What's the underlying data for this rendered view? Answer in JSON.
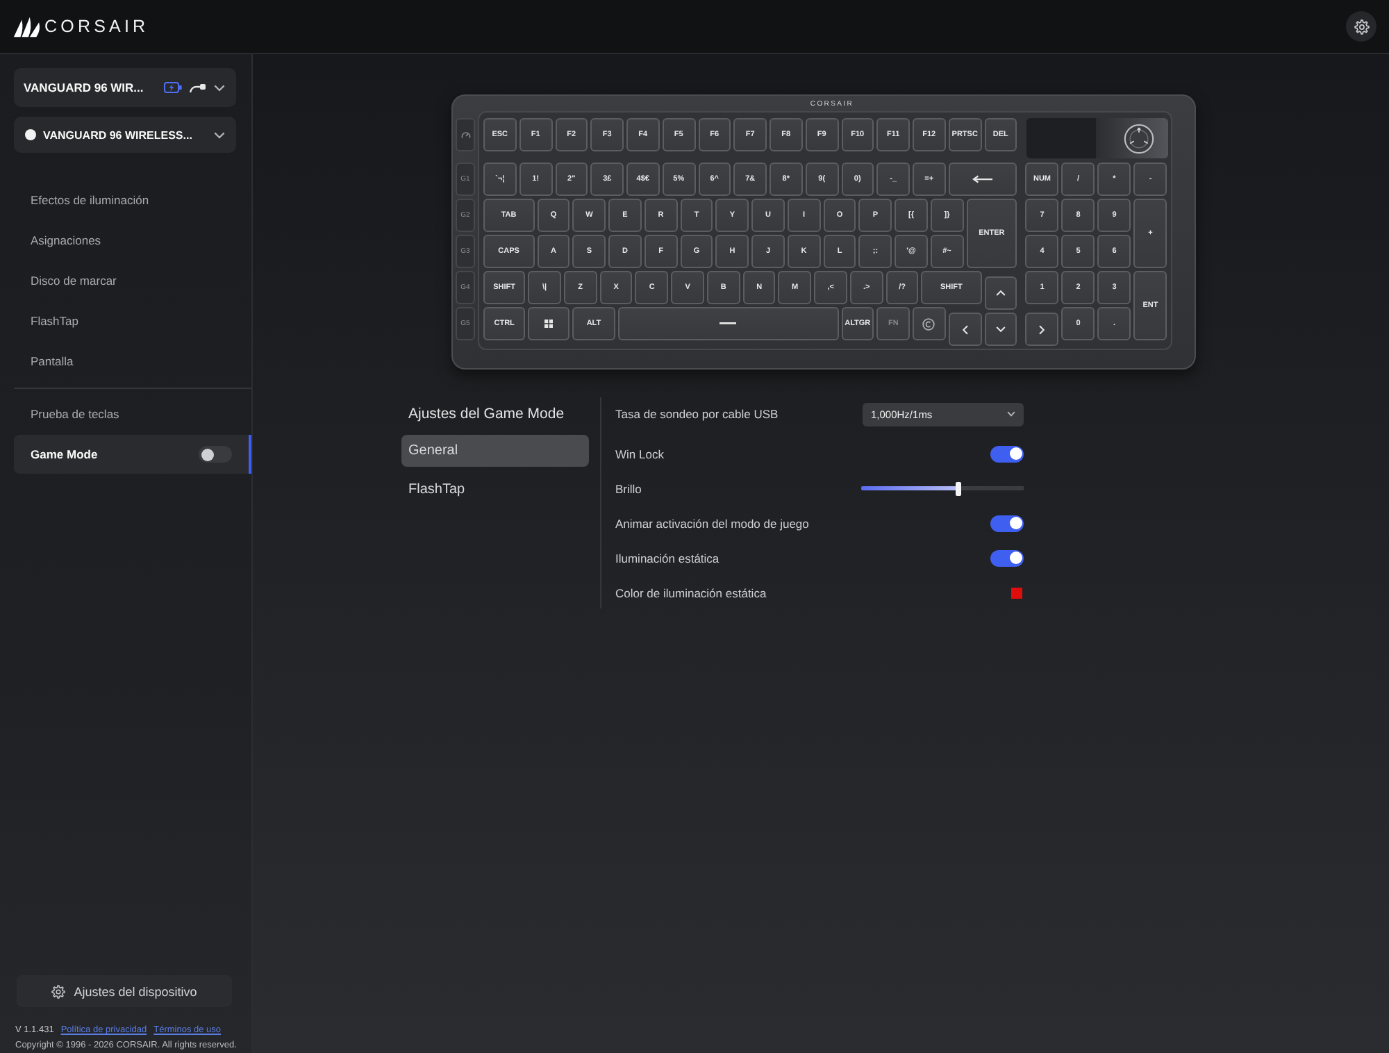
{
  "top_bar": {
    "brand": "CORSAIR"
  },
  "sidebar": {
    "device_selectors": [
      {
        "kind": "device",
        "label": "VANGUARD 96 WIR..."
      },
      {
        "kind": "receiver",
        "label": "VANGUARD 96 WIRELESS..."
      }
    ],
    "menu_groups": [
      {
        "items": [
          {
            "kind": "link",
            "label": "Efectos de iluminación",
            "selected": false
          },
          {
            "kind": "link",
            "label": "Asignaciones",
            "selected": false
          },
          {
            "kind": "link",
            "label": "Disco de marcar",
            "selected": false
          },
          {
            "kind": "link",
            "label": "FlashTap",
            "selected": false
          },
          {
            "kind": "link",
            "label": "Pantalla",
            "selected": false
          }
        ]
      },
      {
        "items": [
          {
            "kind": "link",
            "label": "Prueba de teclas",
            "selected": false
          },
          {
            "kind": "toggle",
            "label": "Game Mode",
            "selected": true,
            "on": false
          }
        ]
      }
    ],
    "device_settings_button": "Ajustes del dispositivo",
    "footer": {
      "version": "V 1.1.431",
      "links": [
        "Política de privacidad",
        "Términos de uso"
      ],
      "copyright": "Copyright © 1996 - 2026 CORSAIR. All rights reserved."
    }
  },
  "keyboard": {
    "brand": "CORSAIR",
    "macro_keys": [
      "G1",
      "G2",
      "G3",
      "G4",
      "G5"
    ],
    "rows": [
      {
        "keys": [
          {
            "kind": "text",
            "label": "ESC"
          },
          {
            "kind": "text",
            "label": "F1"
          },
          {
            "kind": "text",
            "label": "F2"
          },
          {
            "kind": "text",
            "label": "F3"
          },
          {
            "kind": "text",
            "label": "F4"
          },
          {
            "kind": "text",
            "label": "F5"
          },
          {
            "kind": "text",
            "label": "F6"
          },
          {
            "kind": "text",
            "label": "F7"
          },
          {
            "kind": "text",
            "label": "F8"
          },
          {
            "kind": "text",
            "label": "F9"
          },
          {
            "kind": "text",
            "label": "F10"
          },
          {
            "kind": "text",
            "label": "F11"
          },
          {
            "kind": "text",
            "label": "F12"
          },
          {
            "kind": "text",
            "label": "PRTSC"
          },
          {
            "kind": "text",
            "label": "DEL"
          }
        ]
      },
      {
        "keys": [
          {
            "kind": "text",
            "label": "`¬¦"
          },
          {
            "kind": "text",
            "label": "1!"
          },
          {
            "kind": "text",
            "label": "2\""
          },
          {
            "kind": "text",
            "label": "3£"
          },
          {
            "kind": "text",
            "label": "4$€"
          },
          {
            "kind": "text",
            "label": "5%"
          },
          {
            "kind": "text",
            "label": "6^"
          },
          {
            "kind": "text",
            "label": "7&"
          },
          {
            "kind": "text",
            "label": "8*"
          },
          {
            "kind": "text",
            "label": "9("
          },
          {
            "kind": "text",
            "label": "0)"
          },
          {
            "kind": "text",
            "label": "-_"
          },
          {
            "kind": "text",
            "label": "=+"
          },
          {
            "kind": "backspace"
          },
          {
            "kind": "text",
            "label": "NUM"
          },
          {
            "kind": "text",
            "label": "/"
          },
          {
            "kind": "text",
            "label": "*"
          },
          {
            "kind": "text",
            "label": "-"
          }
        ]
      },
      {
        "keys": [
          {
            "kind": "text",
            "label": "TAB"
          },
          {
            "kind": "text",
            "label": "Q"
          },
          {
            "kind": "text",
            "label": "W"
          },
          {
            "kind": "text",
            "label": "E"
          },
          {
            "kind": "text",
            "label": "R"
          },
          {
            "kind": "text",
            "label": "T"
          },
          {
            "kind": "text",
            "label": "Y"
          },
          {
            "kind": "text",
            "label": "U"
          },
          {
            "kind": "text",
            "label": "I"
          },
          {
            "kind": "text",
            "label": "O"
          },
          {
            "kind": "text",
            "label": "P"
          },
          {
            "kind": "text",
            "label": "[{"
          },
          {
            "kind": "text",
            "label": "]}"
          },
          {
            "kind": "text",
            "label": "ENTER"
          },
          {
            "kind": "text",
            "label": "7"
          },
          {
            "kind": "text",
            "label": "8"
          },
          {
            "kind": "text",
            "label": "9"
          },
          {
            "kind": "text",
            "label": "+"
          }
        ]
      },
      {
        "keys": [
          {
            "kind": "text",
            "label": "CAPS"
          },
          {
            "kind": "text",
            "label": "A"
          },
          {
            "kind": "text",
            "label": "S"
          },
          {
            "kind": "text",
            "label": "D"
          },
          {
            "kind": "text",
            "label": "F"
          },
          {
            "kind": "text",
            "label": "G"
          },
          {
            "kind": "text",
            "label": "H"
          },
          {
            "kind": "text",
            "label": "J"
          },
          {
            "kind": "text",
            "label": "K"
          },
          {
            "kind": "text",
            "label": "L"
          },
          {
            "kind": "text",
            "label": ";:"
          },
          {
            "kind": "text",
            "label": "'@"
          },
          {
            "kind": "text",
            "label": "#~"
          },
          {
            "kind": "text",
            "label": "4"
          },
          {
            "kind": "text",
            "label": "5"
          },
          {
            "kind": "text",
            "label": "6"
          }
        ]
      },
      {
        "keys": [
          {
            "kind": "text",
            "label": "SHIFT"
          },
          {
            "kind": "text",
            "label": "\\|"
          },
          {
            "kind": "text",
            "label": "Z"
          },
          {
            "kind": "text",
            "label": "X"
          },
          {
            "kind": "text",
            "label": "C"
          },
          {
            "kind": "text",
            "label": "V"
          },
          {
            "kind": "text",
            "label": "B"
          },
          {
            "kind": "text",
            "label": "N"
          },
          {
            "kind": "text",
            "label": "M"
          },
          {
            "kind": "text",
            "label": ",<"
          },
          {
            "kind": "text",
            "label": ".>"
          },
          {
            "kind": "text",
            "label": "/?"
          },
          {
            "kind": "text",
            "label": "SHIFT"
          },
          {
            "kind": "up"
          },
          {
            "kind": "text",
            "label": "1"
          },
          {
            "kind": "text",
            "label": "2"
          },
          {
            "kind": "text",
            "label": "3"
          },
          {
            "kind": "text",
            "label": "ENT"
          }
        ]
      },
      {
        "keys": [
          {
            "kind": "text",
            "label": "CTRL"
          },
          {
            "kind": "win"
          },
          {
            "kind": "text",
            "label": "ALT"
          },
          {
            "kind": "space"
          },
          {
            "kind": "text",
            "label": "ALTGR"
          },
          {
            "kind": "dim",
            "label": "FN"
          },
          {
            "kind": "logo"
          },
          {
            "kind": "left"
          },
          {
            "kind": "down"
          },
          {
            "kind": "right"
          },
          {
            "kind": "text",
            "label": "0"
          },
          {
            "kind": "text",
            "label": "."
          }
        ]
      }
    ]
  },
  "game_mode_panel": {
    "title": "Ajustes del Game Mode",
    "tabs": [
      {
        "label": "General",
        "selected": true
      },
      {
        "label": "FlashTap",
        "selected": false
      }
    ],
    "settings": [
      {
        "kind": "dropdown",
        "label": "Tasa de sondeo por cable USB",
        "value": "1,000Hz/1ms"
      },
      {
        "kind": "toggle",
        "label": "Win Lock",
        "on": true
      },
      {
        "kind": "slider",
        "label": "Brillo",
        "level": 0.6
      },
      {
        "kind": "toggle",
        "label": "Animar activación del modo de juego",
        "on": true
      },
      {
        "kind": "toggle",
        "label": "Iluminación estática",
        "on": true
      },
      {
        "kind": "color",
        "label": "Color de iluminación estática",
        "color": "#e00d0d"
      }
    ]
  }
}
